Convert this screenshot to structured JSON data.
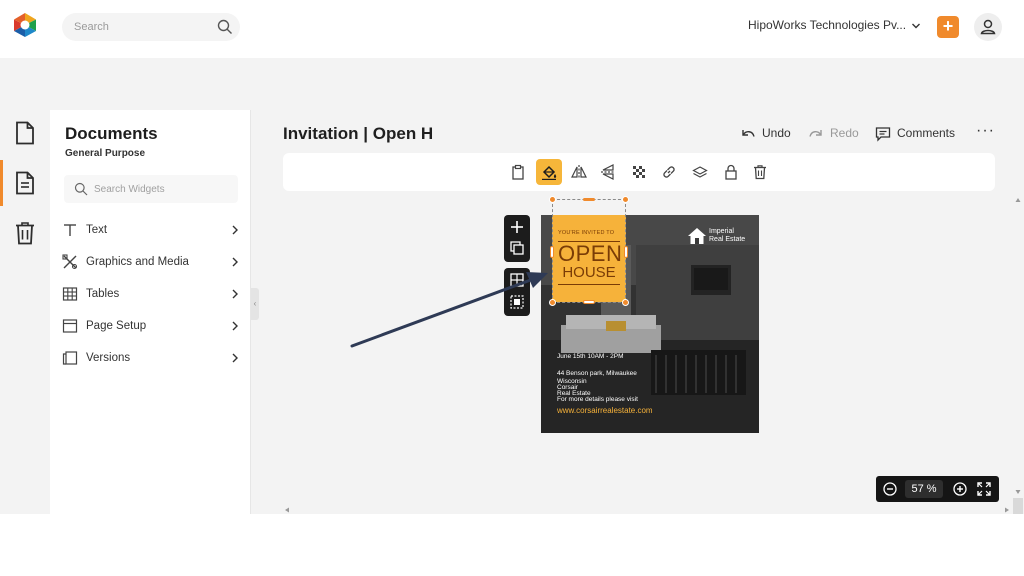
{
  "topbar": {
    "search_placeholder": "Search",
    "company": "HipoWorks Technologies Pv...",
    "add_label": "+"
  },
  "panel": {
    "title": "Documents",
    "subtitle": "General Purpose",
    "search_placeholder": "Search Widgets",
    "items": [
      {
        "label": "Text",
        "icon": "text-icon"
      },
      {
        "label": "Graphics and Media",
        "icon": "graphics-media-icon"
      },
      {
        "label": "Tables",
        "icon": "table-icon"
      },
      {
        "label": "Page Setup",
        "icon": "page-setup-icon"
      },
      {
        "label": "Versions",
        "icon": "versions-icon"
      }
    ]
  },
  "document": {
    "title": "Invitation | Open H",
    "undo_label": "Undo",
    "redo_label": "Redo",
    "comments_label": "Comments",
    "more_label": "···"
  },
  "toolbar": {
    "tools": [
      "clipboard-icon",
      "fill-color-icon",
      "flip-horizontal-icon",
      "flip-vertical-icon",
      "transparency-icon",
      "link-icon",
      "layers-icon",
      "lock-icon",
      "delete-icon"
    ],
    "active_tool": "fill-color-icon"
  },
  "canvas": {
    "brand_line1": "Imperial",
    "brand_line2": "Real Estate",
    "invite_label": "YOU'RE INVITED TO",
    "invite_open": "OPEN",
    "invite_house": "HOUSE",
    "date_line": "June 15th 10AM - 2PM",
    "address_line1": "44 Benson park, Milwaukee",
    "address_line2": "Wisconsin",
    "company_line1": "Corsair",
    "company_line2": "Real Estate",
    "details_line": "For more details please visit",
    "website": "www.corsairrealestate.com"
  },
  "zoom": {
    "value": "57 %"
  },
  "colors": {
    "accent": "#f08a2c",
    "card_yellow": "#f6b23a",
    "card_text": "#7a3c06"
  }
}
